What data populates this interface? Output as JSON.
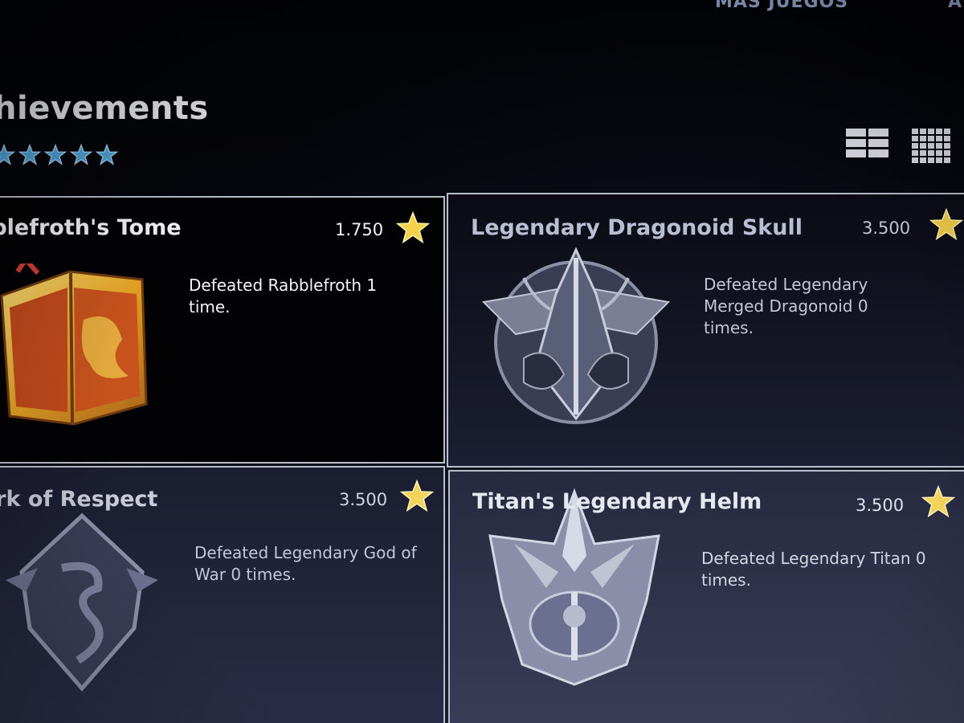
{
  "nav": {
    "top_link": "MÁS JUEGOS",
    "top_link_cut": "A"
  },
  "page": {
    "title": "hievements",
    "rating_stars": 5,
    "colors": {
      "accent_star": "#f2d24a",
      "rating_star": "#4fa3d8"
    }
  },
  "view_toggles": {
    "large_grid_icon": "grid-large-icon",
    "small_grid_icon": "grid-small-icon"
  },
  "achievements": [
    {
      "title": "bblefroth's Tome",
      "points": "1.750",
      "description": "Defeated Rabblefroth 1 time.",
      "icon": "tome-icon",
      "unlocked": true
    },
    {
      "title": "Legendary Dragonoid Skull",
      "points": "3.500",
      "description": "Defeated Legendary Merged Dragonoid 0 times.",
      "icon": "dragon-skull-icon",
      "unlocked": false
    },
    {
      "title": "ark of Respect",
      "points": "3.500",
      "description": "Defeated Legendary God of War 0 times.",
      "icon": "shield-icon",
      "unlocked": false
    },
    {
      "title": "Titan's Legendary Helm",
      "points": "3.500",
      "description": "Defeated Legendary Titan 0 times.",
      "icon": "helm-icon",
      "unlocked": false
    }
  ]
}
